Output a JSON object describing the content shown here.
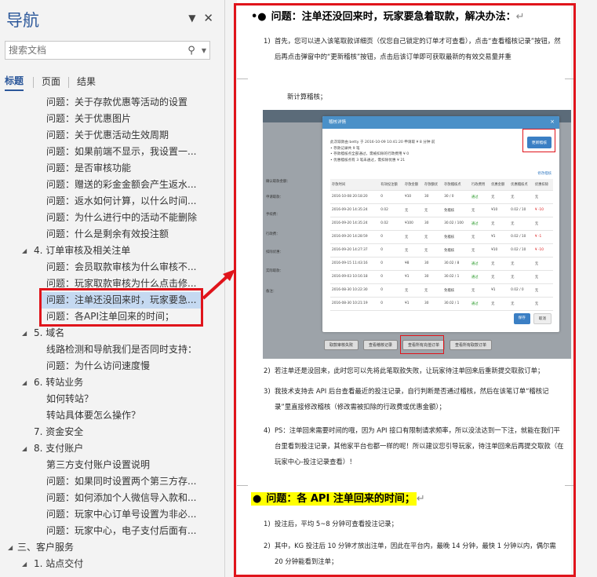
{
  "nav": {
    "title": "导航",
    "dropdown_icon": "chevron-down-icon",
    "close_icon": "close-icon",
    "search_placeholder": "搜索文档",
    "tabs": [
      "标题",
      "页面",
      "结果"
    ],
    "items": [
      {
        "text": "问题：关于存款优惠等活动的设置",
        "level": 2
      },
      {
        "text": "问题：关于优惠图片",
        "level": 2
      },
      {
        "text": "问题：关于优惠活动生效周期",
        "level": 2
      },
      {
        "text": "问题：如果前端不显示，我设置一...",
        "level": 2
      },
      {
        "text": "问题：是否审核功能",
        "level": 2
      },
      {
        "text": "问题：赠送的彩金金额会产生返水...",
        "level": 2
      },
      {
        "text": "问题：返水如何计算，以什么时间...",
        "level": 2
      },
      {
        "text": "问题：为什么进行中的活动不能删除",
        "level": 2
      },
      {
        "text": "问题：什么是剩余有效投注额",
        "level": 2
      },
      {
        "text": "4. 订单审核及相关注单",
        "level": 1,
        "expanded": true
      },
      {
        "text": "问题：会员取款审核为什么审核不...",
        "level": 2
      },
      {
        "text": "问题：玩家取款审核为什么点击修...",
        "level": 2
      },
      {
        "text": "问题：注单还没回来时，玩家要急...",
        "level": 2,
        "selected": true
      },
      {
        "text": "问题：各API注单回来的时间；",
        "level": 2
      },
      {
        "text": "5. 域名",
        "level": 1,
        "expanded": true
      },
      {
        "text": "线路检测和导航我们是否同时支持：",
        "level": 2
      },
      {
        "text": "问题：为什么访问速度慢",
        "level": 2
      },
      {
        "text": "6. 转站业务",
        "level": 1,
        "expanded": true
      },
      {
        "text": "如何转站？",
        "level": 2
      },
      {
        "text": "转站具体要怎么操作？",
        "level": 2
      },
      {
        "text": "7. 资金安全",
        "level": 1
      },
      {
        "text": "8. 支付账户",
        "level": 1,
        "expanded": true
      },
      {
        "text": "第三方支付账户设置说明",
        "level": 2
      },
      {
        "text": "问题：如果同时设置两个第三方存...",
        "level": 2
      },
      {
        "text": "问题：如何添加个人微信导入款和...",
        "level": 2
      },
      {
        "text": "问题：玩家中心订单号设置为非必...",
        "level": 2
      },
      {
        "text": "问题：玩家中心，电子支付后面有...",
        "level": 2
      },
      {
        "text": "三、客户服务",
        "level": 0,
        "expanded": true
      },
      {
        "text": "1. 站点交付",
        "level": 1,
        "expanded": true
      }
    ]
  },
  "doc": {
    "heading1": "问题：注单还没回来时，玩家要急着取款，解决办法：",
    "p1_num": "1)",
    "p1_text": "首先，您可以进入该笔取款详细页（仅您自己锁定的订单才可查看），点击“查看稽核记录”按钮，然后再点击弹窗中的“更新稽核”按钮，点击后该订单即可获取最新的有效交易量并重",
    "p1_cont": "新计算稽核；",
    "p2_num": "2)",
    "p2_text": "若注单还是没回来，此时您可以先将此笔取款失败，让玩家待注单回来后重新提交取款订单；",
    "p3_num": "3)",
    "p3_text": "我技术支持去 API 后台查看最近的投注记录，自行判断是否通过稽核，然后在该笔订单“稽核记录”里直接修改稽核（修改需被扣除的行政费或优惠金额）；",
    "p4_num": "4)",
    "p4_text": "PS：注单回来需要时间的哦，因为 API 接口有限制请求频率，所以没法达到一下注，就能在我们平台里看到投注记录，其他家平台也都一样的呢！所以建议您引导玩家，待注单回来后再提交取款（在玩家中心-投注记录查看）！",
    "heading2": "问题：各 API 注单回来的时间；",
    "q1_num": "1)",
    "q1_text": "投注后，平均 5~8 分钟可查看投注记录；",
    "q2_num": "2)",
    "q2_text": "其中，KG 投注后 10 分钟才放出注单，因此在平台内，最晚 14 分钟，最快 1 分钟以内，偶尔需 20 分钟能看到注单；"
  },
  "screenshot": {
    "dialog_title": "稽核详情",
    "info_line1": "此次取款由 betty 于 2016-10-09 10:41:20 申请取 ¥ 8 分钟 前",
    "info_line2": "• 存款记录共 9 笔",
    "info_line3": "• 存款稽核点全部通过，需被扣除的行政费用 ¥ 0",
    "info_line4": "• 优惠稽核点有 3 笔未通过，需扣除优惠 ¥ 21",
    "refresh_button": "更新稽核",
    "modify_link": "修改稽核",
    "columns": [
      "存款时间",
      "有效投注额",
      "存款金额",
      "存款额优",
      "存款稽核点",
      "行政费用",
      "优惠金额",
      "优惠稽核点",
      "优惠扣除"
    ],
    "rows": [
      [
        "2016-10-08 20:18:20",
        "0",
        "¥10",
        "30",
        "30 / 0",
        "通过",
        "无",
        "无",
        "无"
      ],
      [
        "2016-09-20 14:35:24",
        "0.02",
        "无",
        "无",
        "免稽核",
        "无",
        "¥10",
        "0.02 / 10",
        "¥ -10"
      ],
      [
        "2016-09-20 14:35:24",
        "0.02",
        "¥100",
        "30",
        "30.02 / 100",
        "通过",
        "无",
        "无",
        "无"
      ],
      [
        "2016-09-20 14:28:59",
        "0",
        "无",
        "无",
        "免稽核",
        "无",
        "¥1",
        "0.02 / 10",
        "¥ -1"
      ],
      [
        "2016-09-20 14:27:37",
        "0",
        "无",
        "无",
        "免稽核",
        "无",
        "¥10",
        "0.02 / 10",
        "¥ -10"
      ],
      [
        "2016-09-15 11:43:16",
        "0",
        "¥8",
        "30",
        "30.02 / 8",
        "通过",
        "无",
        "无",
        "无"
      ],
      [
        "2016-09-03 10:16:18",
        "0",
        "¥1",
        "30",
        "30.02 / 1",
        "通过",
        "无",
        "无",
        "无"
      ],
      [
        "2016-08-30 10:22:30",
        "0",
        "无",
        "无",
        "免稽核",
        "无",
        "¥1",
        "0.02 / 0",
        "无"
      ],
      [
        "2016-08-30 10:21:19",
        "0",
        "¥1",
        "30",
        "30.02 / 1",
        "通过",
        "无",
        "无",
        "无"
      ]
    ],
    "save_button": "保存",
    "cancel_button": "取消",
    "side_labels": [
      "确认取款金额：",
      "申请取款：",
      "手续费：",
      "行政费：",
      "扣除优惠：",
      "实际取款：",
      "备注："
    ],
    "bottom_buttons": [
      "取款审核失败",
      "查看稽核记录",
      "查看所有充值订单",
      "查看所有取款订单"
    ]
  },
  "colors": {
    "accent": "#2b579a",
    "annotation_red": "#e0141b",
    "highlight": "#ffff00",
    "dialog_header": "#4a90c8"
  }
}
